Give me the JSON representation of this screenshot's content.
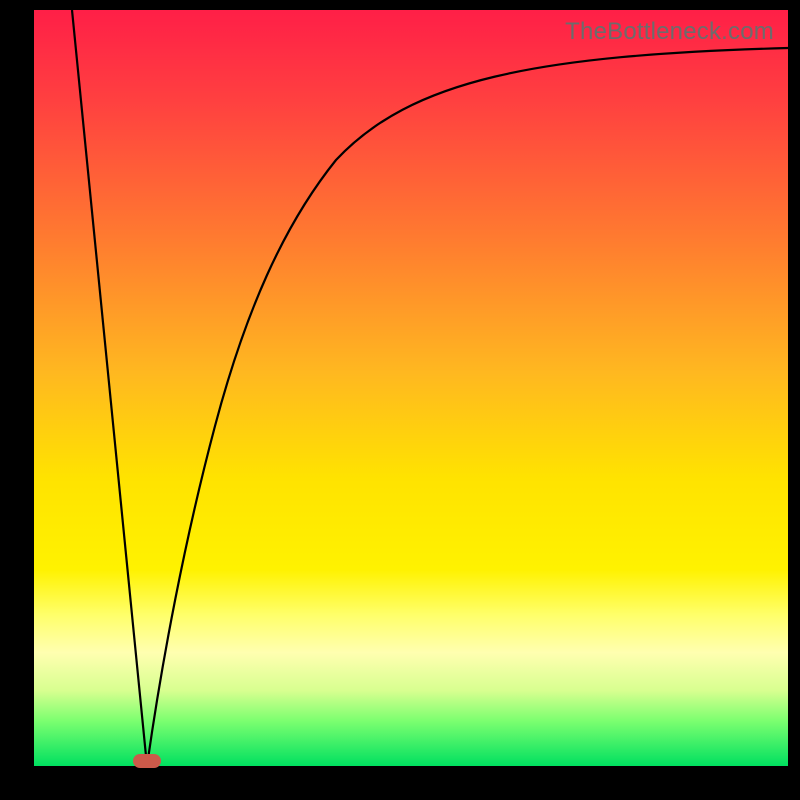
{
  "watermark": "TheBottleneck.com",
  "colors": {
    "frame": "#000000",
    "curve": "#000000",
    "marker": "#cc5a4a",
    "gradient_top": "#ff1f47",
    "gradient_bottom": "#00e060"
  },
  "chart_data": {
    "type": "line",
    "title": "",
    "xlabel": "",
    "ylabel": "",
    "xlim": [
      0,
      100
    ],
    "ylim": [
      0,
      100
    ],
    "grid": false,
    "legend": false,
    "annotations": [
      "TheBottleneck.com"
    ],
    "marker": {
      "x": 15,
      "y": 0
    },
    "series": [
      {
        "name": "left-branch",
        "x": [
          5,
          7,
          9,
          11,
          13,
          15
        ],
        "y": [
          100,
          80,
          60,
          40,
          20,
          0
        ]
      },
      {
        "name": "right-branch",
        "x": [
          15,
          17,
          20,
          24,
          28,
          33,
          40,
          50,
          62,
          78,
          100
        ],
        "y": [
          0,
          14,
          30,
          45,
          56,
          65,
          74,
          82,
          88,
          92,
          95
        ]
      }
    ]
  }
}
